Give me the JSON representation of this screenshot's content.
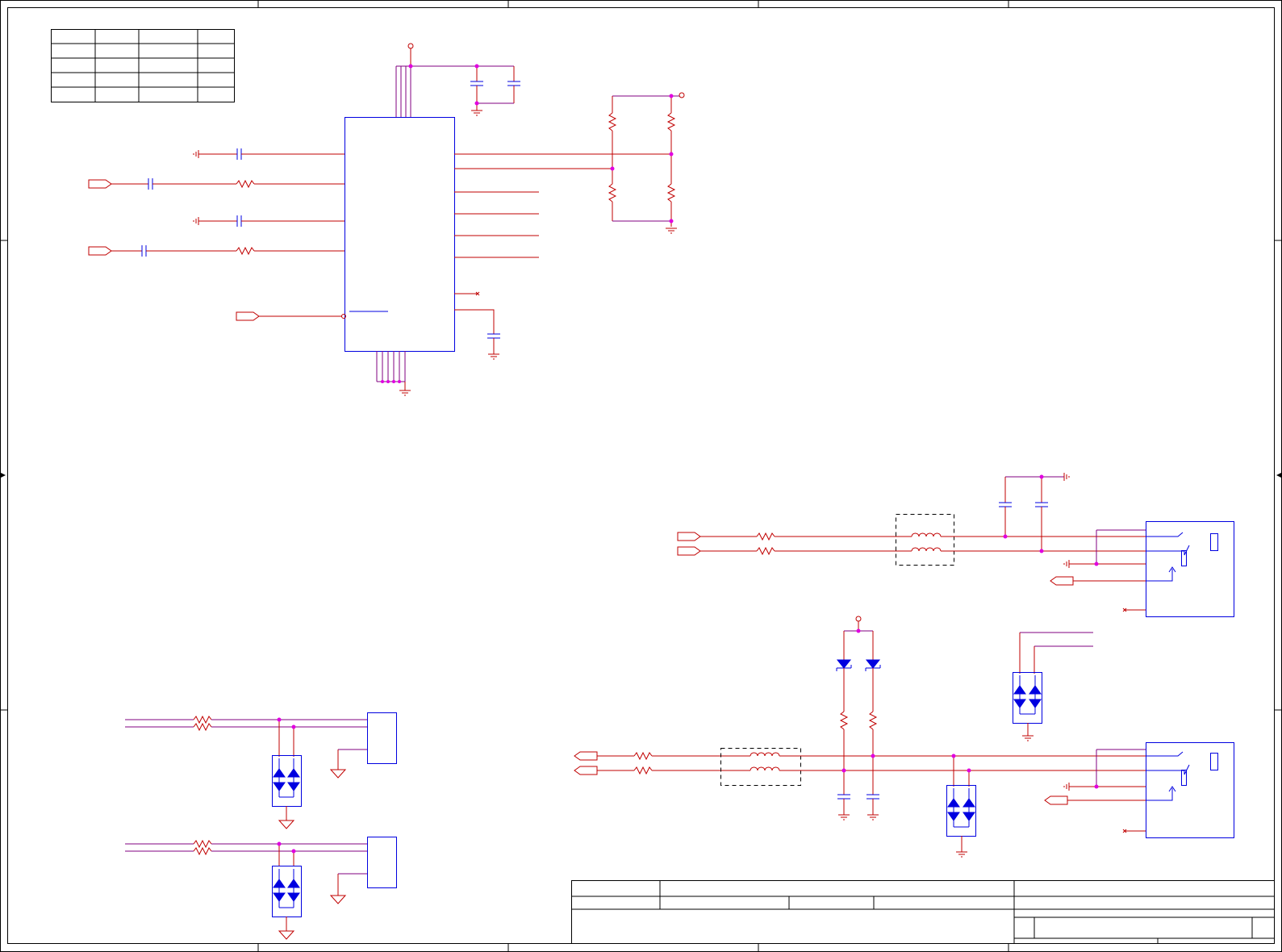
{
  "diagram": {
    "type": "electrical schematic",
    "colors": {
      "frame": "#000000",
      "wire": "#c00000",
      "net": "#800080",
      "component": "#0000e0",
      "junction": "#e000e0"
    },
    "icons": [
      "resistor-icon",
      "capacitor-icon",
      "inductor-icon",
      "ground-icon",
      "power-pin-icon",
      "tvs-diode-icon",
      "zener-diode-icon",
      "audio-jack-icon",
      "port-arrow-icon",
      "no-connect-icon"
    ]
  }
}
